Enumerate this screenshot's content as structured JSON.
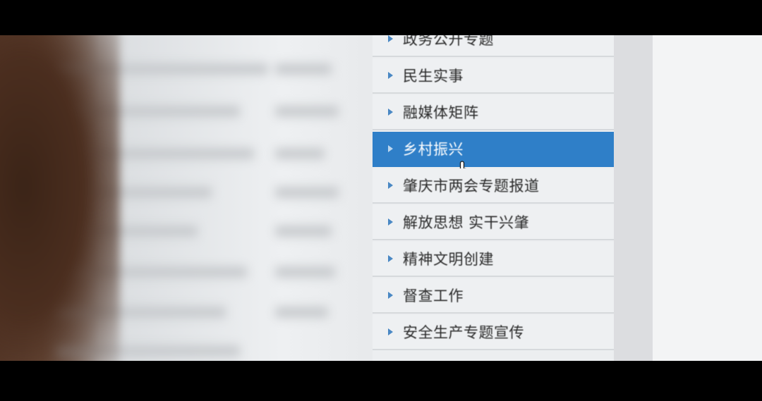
{
  "menu": {
    "items": [
      {
        "label": "政务公开专题",
        "active": false
      },
      {
        "label": "民生实事",
        "active": false
      },
      {
        "label": "融媒体矩阵",
        "active": false
      },
      {
        "label": "乡村振兴",
        "active": true
      },
      {
        "label": "肇庆市两会专题报道",
        "active": false
      },
      {
        "label": "解放思想 实干兴肇",
        "active": false
      },
      {
        "label": "精神文明创建",
        "active": false
      },
      {
        "label": "督查工作",
        "active": false
      },
      {
        "label": "安全生产专题宣传",
        "active": false
      }
    ]
  },
  "colors": {
    "active_background": "#2f7fc8",
    "item_background": "#eef0f2",
    "arrow": "#4a88c4"
  },
  "icons": {
    "arrow": "triangle-right-icon",
    "cursor": "hand-pointer-icon"
  }
}
